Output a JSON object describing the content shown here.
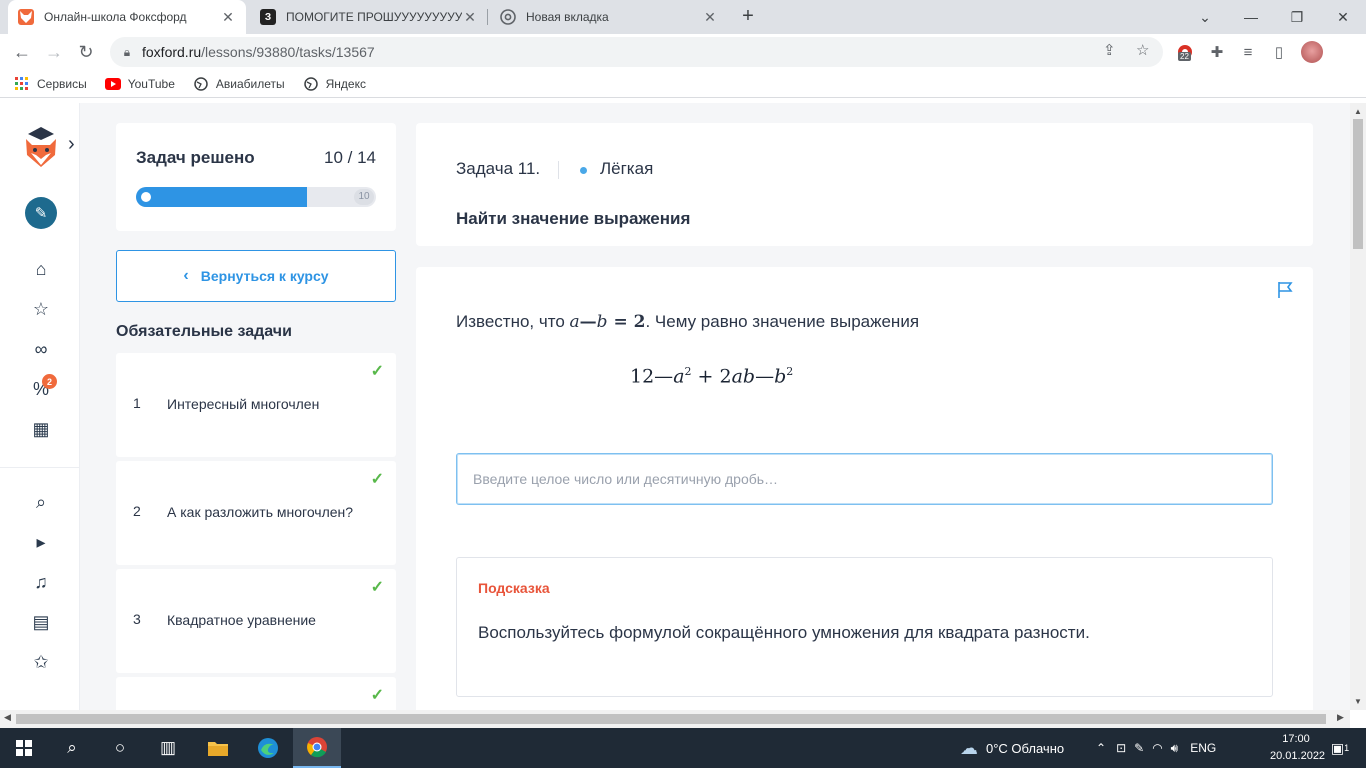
{
  "browser": {
    "tabs": [
      {
        "title": "Онлайн-школа Фоксфорд",
        "favicon_color": "#f06a3c",
        "favicon_char": ""
      },
      {
        "title": "ПОМОГИТЕ ПРОШУУУУУУУУУ",
        "favicon_color": "#222222",
        "favicon_char": "З"
      },
      {
        "title": "Новая вкладка",
        "favicon_color": "#5f6368",
        "favicon_char": ""
      }
    ],
    "url_host": "foxford.ru",
    "url_path": "/lessons/93880/tasks/13567",
    "extension_badge": "22",
    "bookmarks": [
      {
        "label": "Сервисы",
        "icon": "apps-grid-icon"
      },
      {
        "label": "YouTube",
        "icon": "youtube-icon"
      },
      {
        "label": "Авиабилеты",
        "icon": "globe-icon"
      },
      {
        "label": "Яндекс",
        "icon": "globe-icon"
      }
    ]
  },
  "rail": {
    "notification_count": "2"
  },
  "progress": {
    "label": "Задач решено",
    "count": "10 / 14",
    "solved": 10,
    "total": 14,
    "end_marker": "10"
  },
  "back_button": "Вернуться к курсу",
  "section_title": "Обязательные задачи",
  "tasks": [
    {
      "num": "1",
      "title": "Интересный многочлен",
      "done": true
    },
    {
      "num": "2",
      "title": "А как разложить многочлен?",
      "done": true
    },
    {
      "num": "3",
      "title": "Квадратное уравнение",
      "done": true
    },
    {
      "num": "",
      "title": "",
      "done": true
    }
  ],
  "task": {
    "number": "Задача 11.",
    "difficulty": "Лёгкая",
    "title": "Найти значение выражения",
    "statement_prefix": "Известно, что ",
    "statement_math_a": "a",
    "statement_math_dash": "—",
    "statement_math_b": "b",
    "statement_math_eq": " = 2",
    "statement_suffix": ". Чему равно значение выражения",
    "formula_parts": {
      "lead": "12—",
      "a": "a",
      "a_pow": "2",
      "mid": " + 2",
      "ab": "ab",
      "dash": "—",
      "b": "b",
      "b_pow": "2"
    },
    "answer_placeholder": "Введите целое число или десятичную дробь…",
    "answer_value": ""
  },
  "hint": {
    "title": "Подсказка",
    "text": "Воспользуйтесь формулой сокращённого умножения для квадрата разности."
  },
  "taskbar": {
    "weather": "0°C Облачно",
    "lang": "ENG",
    "time": "17:00",
    "date": "20.01.2022",
    "notifications": "1"
  },
  "colors": {
    "accent": "#2e94e4",
    "check": "#58b84a",
    "hint_title": "#e8543a"
  }
}
